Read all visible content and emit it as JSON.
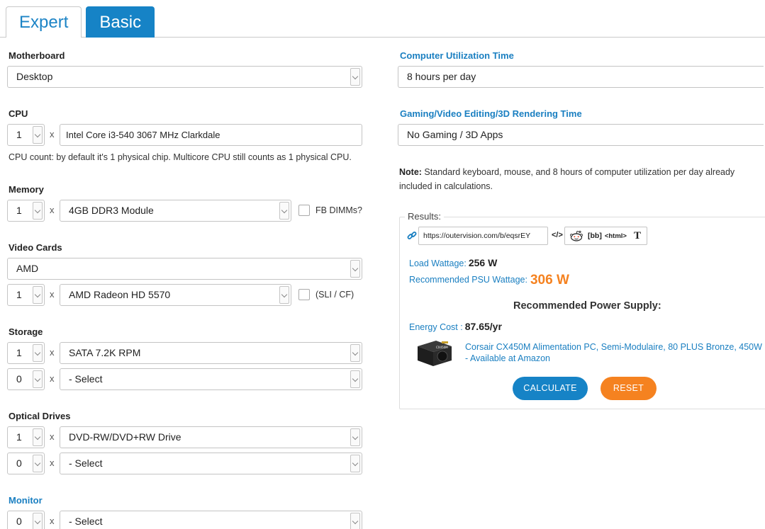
{
  "tabs": {
    "expert": "Expert",
    "basic": "Basic"
  },
  "motherboard": {
    "label": "Motherboard",
    "value": "Desktop"
  },
  "cpu": {
    "label": "CPU",
    "qty": "1",
    "x": "x",
    "value": "Intel Core i3-540 3067 MHz Clarkdale",
    "help": "CPU count: by default it's 1 physical chip. Multicore CPU still counts as 1 physical CPU."
  },
  "memory": {
    "label": "Memory",
    "qty": "1",
    "x": "x",
    "value": "4GB DDR3 Module",
    "checkbox_label": "FB DIMMs?"
  },
  "video": {
    "label": "Video Cards",
    "brand": "AMD",
    "qty": "1",
    "x": "x",
    "value": "AMD Radeon HD 5570",
    "checkbox_label": "(SLI / CF)"
  },
  "storage": {
    "label": "Storage",
    "rows": [
      {
        "qty": "1",
        "x": "x",
        "value": "SATA 7.2K RPM"
      },
      {
        "qty": "0",
        "x": "x",
        "value": "- Select"
      }
    ]
  },
  "optical": {
    "label": "Optical Drives",
    "rows": [
      {
        "qty": "1",
        "x": "x",
        "value": "DVD-RW/DVD+RW Drive"
      },
      {
        "qty": "0",
        "x": "x",
        "value": "- Select"
      }
    ]
  },
  "monitor": {
    "label": "Monitor",
    "qty": "0",
    "x": "x",
    "value": "- Select"
  },
  "utilization": {
    "label": "Computer Utilization Time",
    "value": "8 hours per day"
  },
  "gaming": {
    "label": "Gaming/Video Editing/3D Rendering Time",
    "value": "No Gaming / 3D Apps"
  },
  "note": {
    "bold": "Note:",
    "text": " Standard keyboard, mouse, and 8 hours of computer utilization per day already included in calculations."
  },
  "results": {
    "legend": "Results:",
    "url": "https://outervision.com/b/eqsrEY",
    "code": "</>",
    "bb": "[bb]",
    "html": "<html>",
    "t": "T",
    "load_label": "Load Wattage:",
    "load_value": "256 W",
    "psu_label": "Recommended PSU Wattage:",
    "psu_value": "306 W",
    "rec_title": "Recommended Power Supply:",
    "energy_label": "Energy Cost :",
    "energy_value": "87.65/yr",
    "product": "Corsair CX450M Alimentation PC, Semi-Modulaire, 80 PLUS Bronze, 450W - Available at Amazon",
    "psu_badge": "CX450M"
  },
  "buttons": {
    "calculate": "CALCULATE",
    "reset": "RESET"
  },
  "colors": {
    "accent_blue": "#1683c6",
    "accent_orange": "#f58220"
  }
}
